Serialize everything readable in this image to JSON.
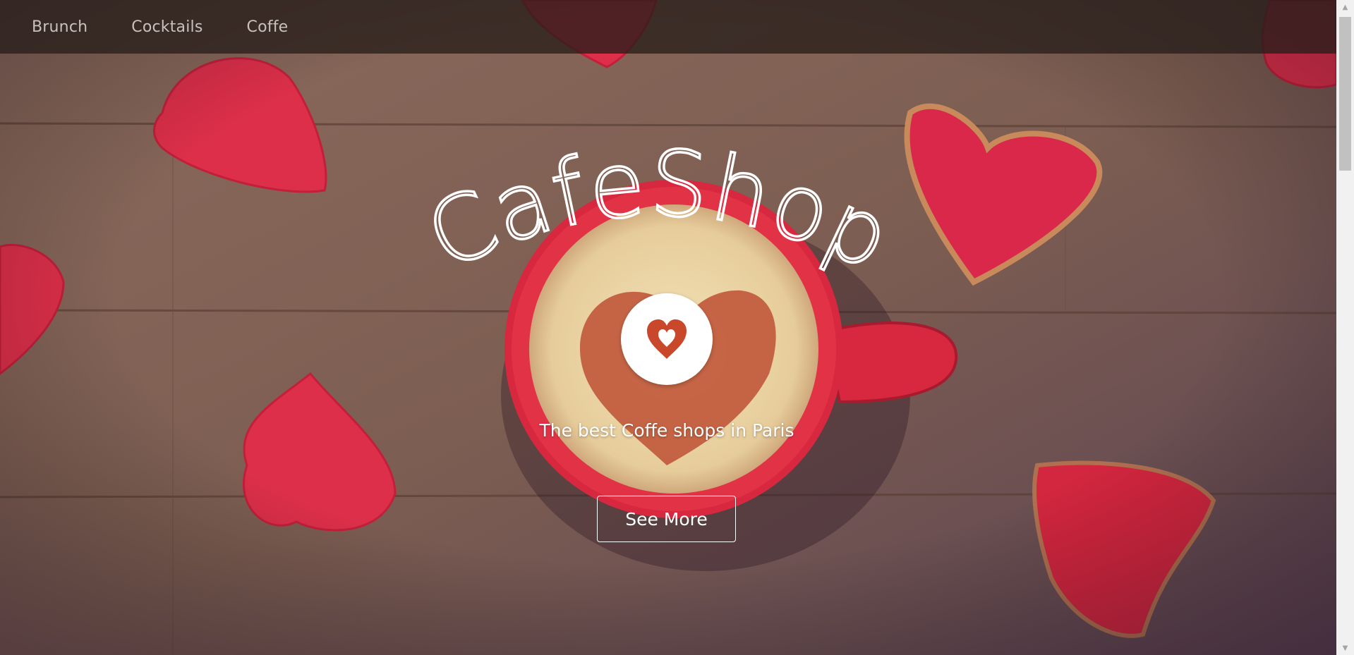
{
  "nav": {
    "items": [
      {
        "label": "Brunch"
      },
      {
        "label": "Cocktails"
      },
      {
        "label": "Coffe"
      }
    ]
  },
  "hero": {
    "title_letters": [
      "C",
      "a",
      "f",
      "e",
      "S",
      "h",
      "o",
      "p"
    ],
    "badge_icon": "heart-icon",
    "tagline": "The best Coffe shops in Paris",
    "cta_label": "See More"
  },
  "colors": {
    "accent_red": "#d8283f",
    "navbar_bg": "#281e19",
    "text_white": "#ffffff",
    "nav_text": "#c9c1bb"
  },
  "scrollbar": {
    "up_icon": "scroll-up-arrow-icon",
    "down_icon": "scroll-down-arrow-icon"
  }
}
